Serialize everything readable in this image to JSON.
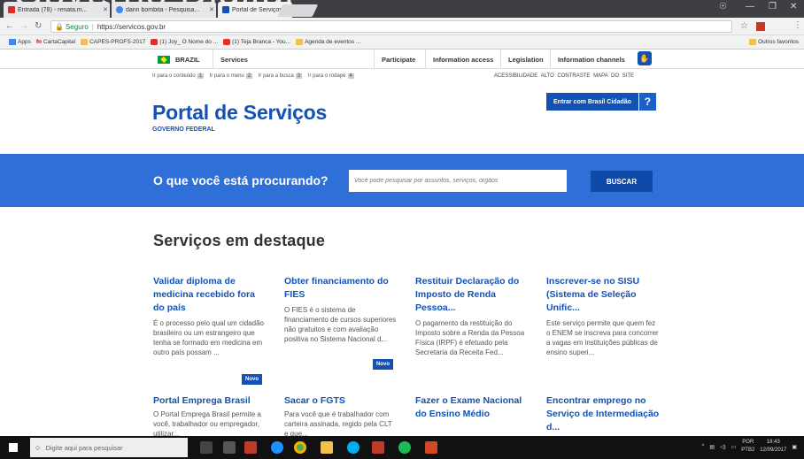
{
  "browser": {
    "overlay_text": "Governo Digital",
    "tabs": [
      {
        "label": "Entrada (78) - renata.m..."
      },
      {
        "label": "darin bombita - Pesquisa..."
      },
      {
        "label": "Portal de Serviços - Págin..."
      }
    ],
    "address": {
      "secure_label": "Seguro",
      "url": "https://servicos.gov.br"
    },
    "bookmarks": [
      "Apps",
      "CartaCapital",
      "CAPES-PROFS-2017",
      "(1) Joy_ O Nome do ...",
      "(1) Teja Branca - You...",
      "Agenda de eventos ..."
    ],
    "other_bookmarks": "Outros favoritos"
  },
  "govbar": {
    "country": "BRAZIL",
    "services": "Services",
    "links": [
      "Participate",
      "Information access",
      "Legislation",
      "Information channels"
    ]
  },
  "skip": {
    "items": [
      {
        "label": "Ir para o conteúdo",
        "num": "1"
      },
      {
        "label": "Ir para o menu",
        "num": "2"
      },
      {
        "label": "Ir para a busca",
        "num": "3"
      },
      {
        "label": "Ir para o rodapé",
        "num": "4"
      }
    ],
    "accessibility": "ACESSIBILIDADE",
    "contrast": "ALTO CONTRASTE",
    "sitemap": "MAPA DO SITE"
  },
  "brand": {
    "title": "Portal de Serviços",
    "subtitle": "GOVERNO FEDERAL"
  },
  "login": {
    "label": "Entrar com Brasil Cidadão",
    "help": "?"
  },
  "search": {
    "question": "O que você está procurando?",
    "placeholder": "Você pode pesquisar por assuntos, serviços, órgãos",
    "button": "BUSCAR"
  },
  "featured": {
    "title": "Serviços em destaque",
    "badge": "Novo",
    "cards": [
      {
        "title": "Validar diploma de medicina recebido fora do país",
        "desc": "É o processo pelo qual um cidadão brasileiro ou um estrangeiro que tenha se formado em medicina em outro país possam ..."
      },
      {
        "title": "Obter financiamento do FIES",
        "desc": "O FIES é o sistema de financiamento de cursos superiores não gratuitos e com avaliação positiva no Sistema Nacional d..."
      },
      {
        "title": "Restituir Declaração do Imposto de Renda Pessoa...",
        "desc": "O pagamento da restituição do Imposto sobre a Renda da Pessoa Física (IRPF) é efetuado pela Secretaria da Receita Fed..."
      },
      {
        "title": "Inscrever-se no SISU (Sistema de Seleção Unific...",
        "desc": "Este serviço permite que quem fez o ENEM se inscreva para concorrer a vagas em instituições públicas de ensino superi..."
      },
      {
        "title": "Portal Emprega Brasil",
        "desc": "O Portal Emprega Brasil permite a você, trabalhador ou empregador, utilizar..."
      },
      {
        "title": "Sacar o FGTS",
        "desc": "Para você que é trabalhador com carteira assinada, regido pela CLT e que..."
      },
      {
        "title": "Fazer o Exame Nacional do Ensino Médio",
        "desc": ""
      },
      {
        "title": "Encontrar emprego no Serviço de Intermediação d...",
        "desc": ""
      }
    ]
  },
  "taskbar": {
    "search_placeholder": "Digite aqui para pesquisar",
    "lang": "POR",
    "layout": "PTB2",
    "time": "18:43",
    "date": "12/09/2017"
  }
}
